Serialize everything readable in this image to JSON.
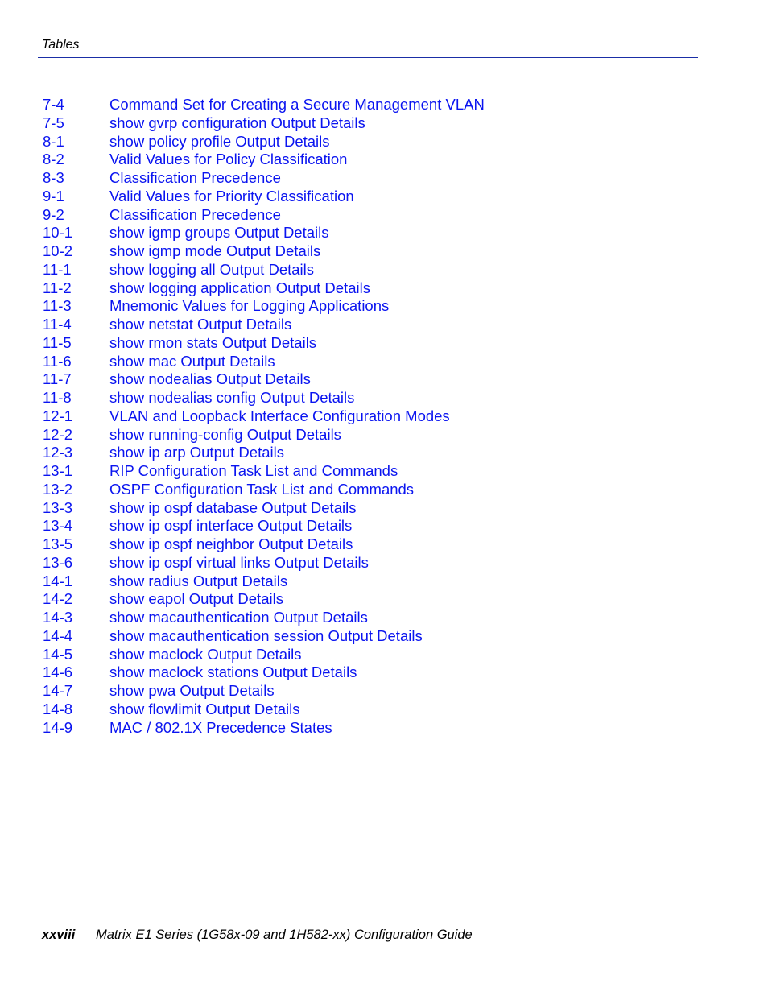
{
  "header": {
    "title": "Tables",
    "rule_color": "#1a2ea6"
  },
  "link_color": "#0a14f0",
  "toc": [
    {
      "number": "7-4",
      "title": "Command Set for Creating a Secure Management VLAN"
    },
    {
      "number": "7-5",
      "title": "show gvrp configuration Output Details"
    },
    {
      "number": "8-1",
      "title": "show policy profile Output Details"
    },
    {
      "number": "8-2",
      "title": "Valid Values for Policy Classification"
    },
    {
      "number": "8-3",
      "title": "Classification Precedence"
    },
    {
      "number": "9-1",
      "title": "Valid Values for Priority Classification"
    },
    {
      "number": "9-2",
      "title": "Classification Precedence"
    },
    {
      "number": "10-1",
      "title": "show igmp groups Output Details"
    },
    {
      "number": "10-2",
      "title": "show igmp mode Output Details"
    },
    {
      "number": "11-1",
      "title": "show logging all Output Details"
    },
    {
      "number": "11-2",
      "title": "show logging application Output Details"
    },
    {
      "number": "11-3",
      "title": "Mnemonic Values for Logging Applications"
    },
    {
      "number": "11-4",
      "title": "show netstat Output Details"
    },
    {
      "number": "11-5",
      "title": "show rmon stats Output Details"
    },
    {
      "number": "11-6",
      "title": "show mac Output Details"
    },
    {
      "number": "11-7",
      "title": "show nodealias Output Details"
    },
    {
      "number": "11-8",
      "title": "show nodealias config Output Details"
    },
    {
      "number": "12-1",
      "title": "VLAN and Loopback Interface Configuration Modes"
    },
    {
      "number": "12-2",
      "title": "show running-config Output Details"
    },
    {
      "number": "12-3",
      "title": "show ip arp Output Details"
    },
    {
      "number": "13-1",
      "title": "RIP Configuration Task List and Commands"
    },
    {
      "number": "13-2",
      "title": "OSPF Configuration Task List and Commands"
    },
    {
      "number": "13-3",
      "title": "show ip ospf database Output Details"
    },
    {
      "number": "13-4",
      "title": "show ip ospf interface Output Details"
    },
    {
      "number": "13-5",
      "title": "show ip ospf neighbor Output Details"
    },
    {
      "number": "13-6",
      "title": "show ip ospf virtual links Output Details"
    },
    {
      "number": "14-1",
      "title": "show radius Output Details"
    },
    {
      "number": "14-2",
      "title": "show eapol Output Details"
    },
    {
      "number": "14-3",
      "title": "show macauthentication Output Details"
    },
    {
      "number": "14-4",
      "title": "show macauthentication session Output Details"
    },
    {
      "number": "14-5",
      "title": "show maclock Output Details"
    },
    {
      "number": "14-6",
      "title": "show maclock stations Output Details"
    },
    {
      "number": "14-7",
      "title": "show pwa Output Details"
    },
    {
      "number": "14-8",
      "title": "show flowlimit Output Details"
    },
    {
      "number": "14-9",
      "title": "MAC / 802.1X Precedence States"
    }
  ],
  "footer": {
    "page_number": "xxviii",
    "book_title": "Matrix E1 Series (1G58x-09 and 1H582-xx) Configuration Guide"
  }
}
